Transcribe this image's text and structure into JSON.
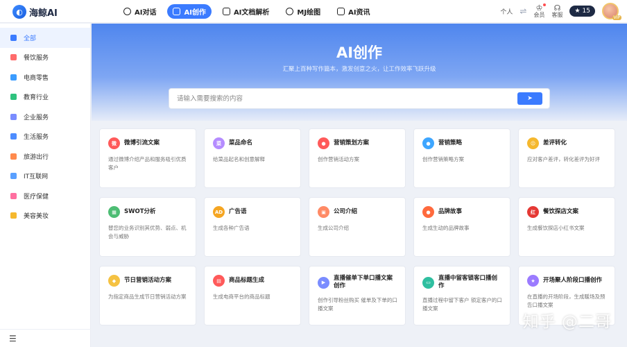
{
  "brand": {
    "name": "海鲸AI"
  },
  "nav": {
    "tabs": [
      {
        "label": "AI对话",
        "active": false,
        "icon": "chat-icon"
      },
      {
        "label": "AI创作",
        "active": true,
        "icon": "compose-icon"
      },
      {
        "label": "AI文档解析",
        "active": false,
        "icon": "document-icon"
      },
      {
        "label": "MJ绘图",
        "active": false,
        "icon": "palette-icon"
      },
      {
        "label": "AI资讯",
        "active": false,
        "icon": "news-icon"
      }
    ]
  },
  "top_right": {
    "personal": "个人",
    "member": "会员",
    "service": "客服",
    "coins": "15",
    "vip": "VIP"
  },
  "sidebar": {
    "items": [
      {
        "label": "全部",
        "active": true,
        "color": "#3b7bff"
      },
      {
        "label": "餐饮服务",
        "active": false,
        "color": "#ff6b6b"
      },
      {
        "label": "电商零售",
        "active": false,
        "color": "#3b9cff"
      },
      {
        "label": "教育行业",
        "active": false,
        "color": "#2ec27e"
      },
      {
        "label": "企业服务",
        "active": false,
        "color": "#7a8cff"
      },
      {
        "label": "生活服务",
        "active": false,
        "color": "#4d8dff"
      },
      {
        "label": "旅游出行",
        "active": false,
        "color": "#ff8a4d"
      },
      {
        "label": "IT互联网",
        "active": false,
        "color": "#5aa0ff"
      },
      {
        "label": "医疗保健",
        "active": false,
        "color": "#ff6fa0"
      },
      {
        "label": "美容美妆",
        "active": false,
        "color": "#f5b82e"
      }
    ],
    "menu_icon": "☰"
  },
  "hero": {
    "title": "AI创作",
    "subtitle": "汇聚上百种写作篇本，激发创意之火，让工作效率飞跃升级",
    "search_placeholder": "请输入需要搜索的内容",
    "search_button": "➤"
  },
  "cards": [
    {
      "title": "微博引流文案",
      "desc": "通过微博介绍产品和服务吸引优质客户",
      "color": "#ff5a5a",
      "glyph": "微"
    },
    {
      "title": "菜品命名",
      "desc": "给菜品起名和创意解释",
      "color": "#b58cff",
      "glyph": "菜"
    },
    {
      "title": "营销策划方案",
      "desc": "创作营销活动方案",
      "color": "#ff5a5a",
      "glyph": "●"
    },
    {
      "title": "营销策略",
      "desc": "创作营销策略方案",
      "color": "#3ea6ff",
      "glyph": "●"
    },
    {
      "title": "差评转化",
      "desc": "应对客户差评，转化差评为好评",
      "color": "#f5b82e",
      "glyph": "☹"
    },
    {
      "title": "SWOT分析",
      "desc": "替您的业务识别其优势、弱点、机会与威胁",
      "color": "#4dbd74",
      "glyph": "▦"
    },
    {
      "title": "广告语",
      "desc": "生成各种广告语",
      "color": "#f5a623",
      "glyph": "AD"
    },
    {
      "title": "公司介绍",
      "desc": "生成公司介绍",
      "color": "#ff8a65",
      "glyph": "▣"
    },
    {
      "title": "品牌故事",
      "desc": "生成生动的品牌故事",
      "color": "#ff6a3d",
      "glyph": "●"
    },
    {
      "title": "餐饮探店文案",
      "desc": "生成餐饮探店小红书文案",
      "color": "#e53935",
      "glyph": "红"
    },
    {
      "title": "节日营销活动方案",
      "desc": "为指定商品生成节日营销活动方案",
      "color": "#f5c242",
      "glyph": "◆"
    },
    {
      "title": "商品标题生成",
      "desc": "生成电商平台的商品标题",
      "color": "#ff5a5a",
      "glyph": "▤"
    },
    {
      "title": "直播催单下单口播文案创作",
      "desc": "创作引导粉丝购买 催单及下单的口播文案",
      "color": "#7a8cff",
      "glyph": "▶"
    },
    {
      "title": "直播中留客锁客口播创作",
      "desc": "直播过程中留下客户 锁定客户的口播文案",
      "color": "#2fbfa0",
      "glyph": "▭"
    },
    {
      "title": "开场聚人阶段口播创作",
      "desc": "在直播的开场阶段，生成暖场及预告口播文案",
      "color": "#9b7bff",
      "glyph": "★"
    }
  ],
  "watermark": "知乎 @二哥"
}
